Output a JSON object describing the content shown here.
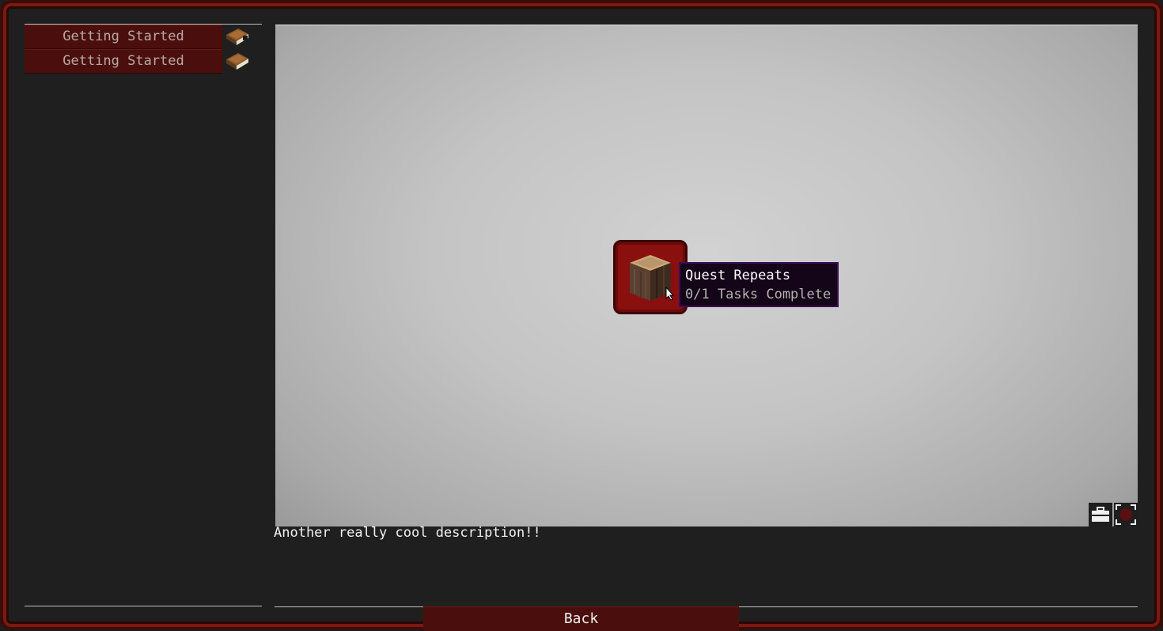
{
  "chapters": [
    {
      "label": "Getting Started",
      "icon": "book-icon"
    },
    {
      "label": "Getting Started",
      "icon": "book-icon"
    }
  ],
  "quest": {
    "icon": "log-block-icon",
    "tooltip_title": "Quest Repeats",
    "tooltip_status": "0/1 Tasks Complete"
  },
  "description": "Another really cool description!!",
  "view_controls": [
    {
      "icon": "toolbox-icon"
    },
    {
      "icon": "fullscreen-icon"
    }
  ],
  "back_label": "Back",
  "colors": {
    "accent": "#4a0f0d",
    "frame": "#7a1a10",
    "quest_node": "#8a0f0f",
    "tooltip_bg": "#140518"
  }
}
